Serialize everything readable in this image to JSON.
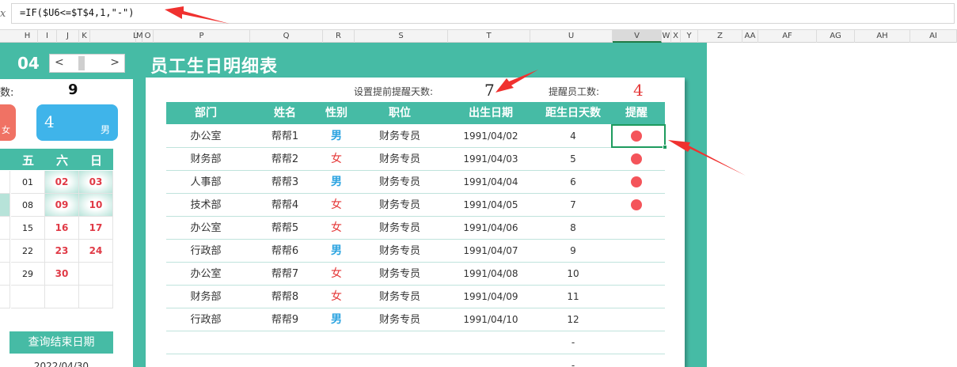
{
  "formula_bar": {
    "fx": "x",
    "formula": "=IF($U6<=$T$4,1,\"-\")"
  },
  "columns": [
    "H",
    "I",
    "J",
    "K",
    "L",
    "M",
    "O",
    "P",
    "Q",
    "R",
    "S",
    "T",
    "U",
    "V",
    "W",
    "X",
    "Y",
    "Z",
    "AA",
    "AF",
    "AG",
    "AH",
    "AI"
  ],
  "calendar": {
    "month": "04",
    "nav_prev": "<",
    "nav_next": ">",
    "count_label": "数:",
    "count_value": "9",
    "female_label": "女",
    "male_value": "4",
    "male_label": "男",
    "weekday_headers": [
      "五",
      "六",
      "日"
    ],
    "rows": [
      [
        "01",
        "02",
        "03"
      ],
      [
        "08",
        "09",
        "10"
      ],
      [
        "15",
        "16",
        "17"
      ],
      [
        "22",
        "23",
        "24"
      ],
      [
        "29",
        "30",
        ""
      ],
      [
        "",
        "",
        ""
      ]
    ],
    "query_end_label": "查询结束日期",
    "query_end_date": "2022/04/30"
  },
  "main": {
    "title": "员工生日明细表",
    "remind_days_label": "设置提前提醒天数:",
    "remind_days_value": "7",
    "remind_emp_label": "提醒员工数:",
    "remind_emp_value": "4",
    "headers": [
      "部门",
      "姓名",
      "性别",
      "职位",
      "出生日期",
      "距生日天数",
      "提醒"
    ],
    "rows": [
      {
        "dept": "办公室",
        "name": "帮帮1",
        "gender": "男",
        "position": "财务专员",
        "birth": "1991/04/02",
        "days": "4",
        "remind": true
      },
      {
        "dept": "财务部",
        "name": "帮帮2",
        "gender": "女",
        "position": "财务专员",
        "birth": "1991/04/03",
        "days": "5",
        "remind": true
      },
      {
        "dept": "人事部",
        "name": "帮帮3",
        "gender": "男",
        "position": "财务专员",
        "birth": "1991/04/04",
        "days": "6",
        "remind": true
      },
      {
        "dept": "技术部",
        "name": "帮帮4",
        "gender": "女",
        "position": "财务专员",
        "birth": "1991/04/05",
        "days": "7",
        "remind": true
      },
      {
        "dept": "办公室",
        "name": "帮帮5",
        "gender": "女",
        "position": "财务专员",
        "birth": "1991/04/06",
        "days": "8",
        "remind": false
      },
      {
        "dept": "行政部",
        "name": "帮帮6",
        "gender": "男",
        "position": "财务专员",
        "birth": "1991/04/07",
        "days": "9",
        "remind": false
      },
      {
        "dept": "办公室",
        "name": "帮帮7",
        "gender": "女",
        "position": "财务专员",
        "birth": "1991/04/08",
        "days": "10",
        "remind": false
      },
      {
        "dept": "财务部",
        "name": "帮帮8",
        "gender": "女",
        "position": "财务专员",
        "birth": "1991/04/09",
        "days": "11",
        "remind": false
      },
      {
        "dept": "行政部",
        "name": "帮帮9",
        "gender": "男",
        "position": "财务专员",
        "birth": "1991/04/10",
        "days": "12",
        "remind": false
      },
      {
        "dept": "",
        "name": "",
        "gender": "",
        "position": "",
        "birth": "",
        "days": "-",
        "remind": false
      },
      {
        "dept": "",
        "name": "",
        "gender": "",
        "position": "",
        "birth": "",
        "days": "-",
        "remind": false
      }
    ]
  },
  "colors": {
    "teal": "#46bba5",
    "male": "#2aa3e0",
    "female": "#e53a3a",
    "dot": "#f4545a",
    "selection": "#1e9b5e",
    "arrow": "#f0312f"
  }
}
